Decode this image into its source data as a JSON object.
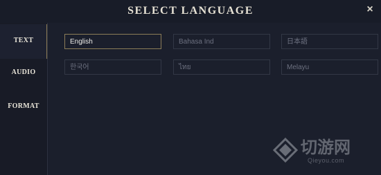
{
  "dialog": {
    "title": "SELECT LANGUAGE",
    "close_label": "×"
  },
  "sidebar": {
    "tabs": [
      {
        "label": "TEXT",
        "active": true
      },
      {
        "label": "AUDIO",
        "active": false
      },
      {
        "label": "FORMAT",
        "active": false
      }
    ]
  },
  "languages": [
    {
      "label": "English",
      "selected": true
    },
    {
      "label": "Bahasa Ind",
      "selected": false
    },
    {
      "label": "日本語",
      "selected": false
    },
    {
      "label": "한국어",
      "selected": false
    },
    {
      "label": "ไทย",
      "selected": false
    },
    {
      "label": "Melayu",
      "selected": false
    }
  ],
  "watermark": {
    "brand": "切游网",
    "url": "Qieyou.com"
  },
  "colors": {
    "background": "#1a1e2b",
    "accent": "#8c7d58",
    "text_primary": "#e6e1d4",
    "text_muted": "#6d7180"
  }
}
